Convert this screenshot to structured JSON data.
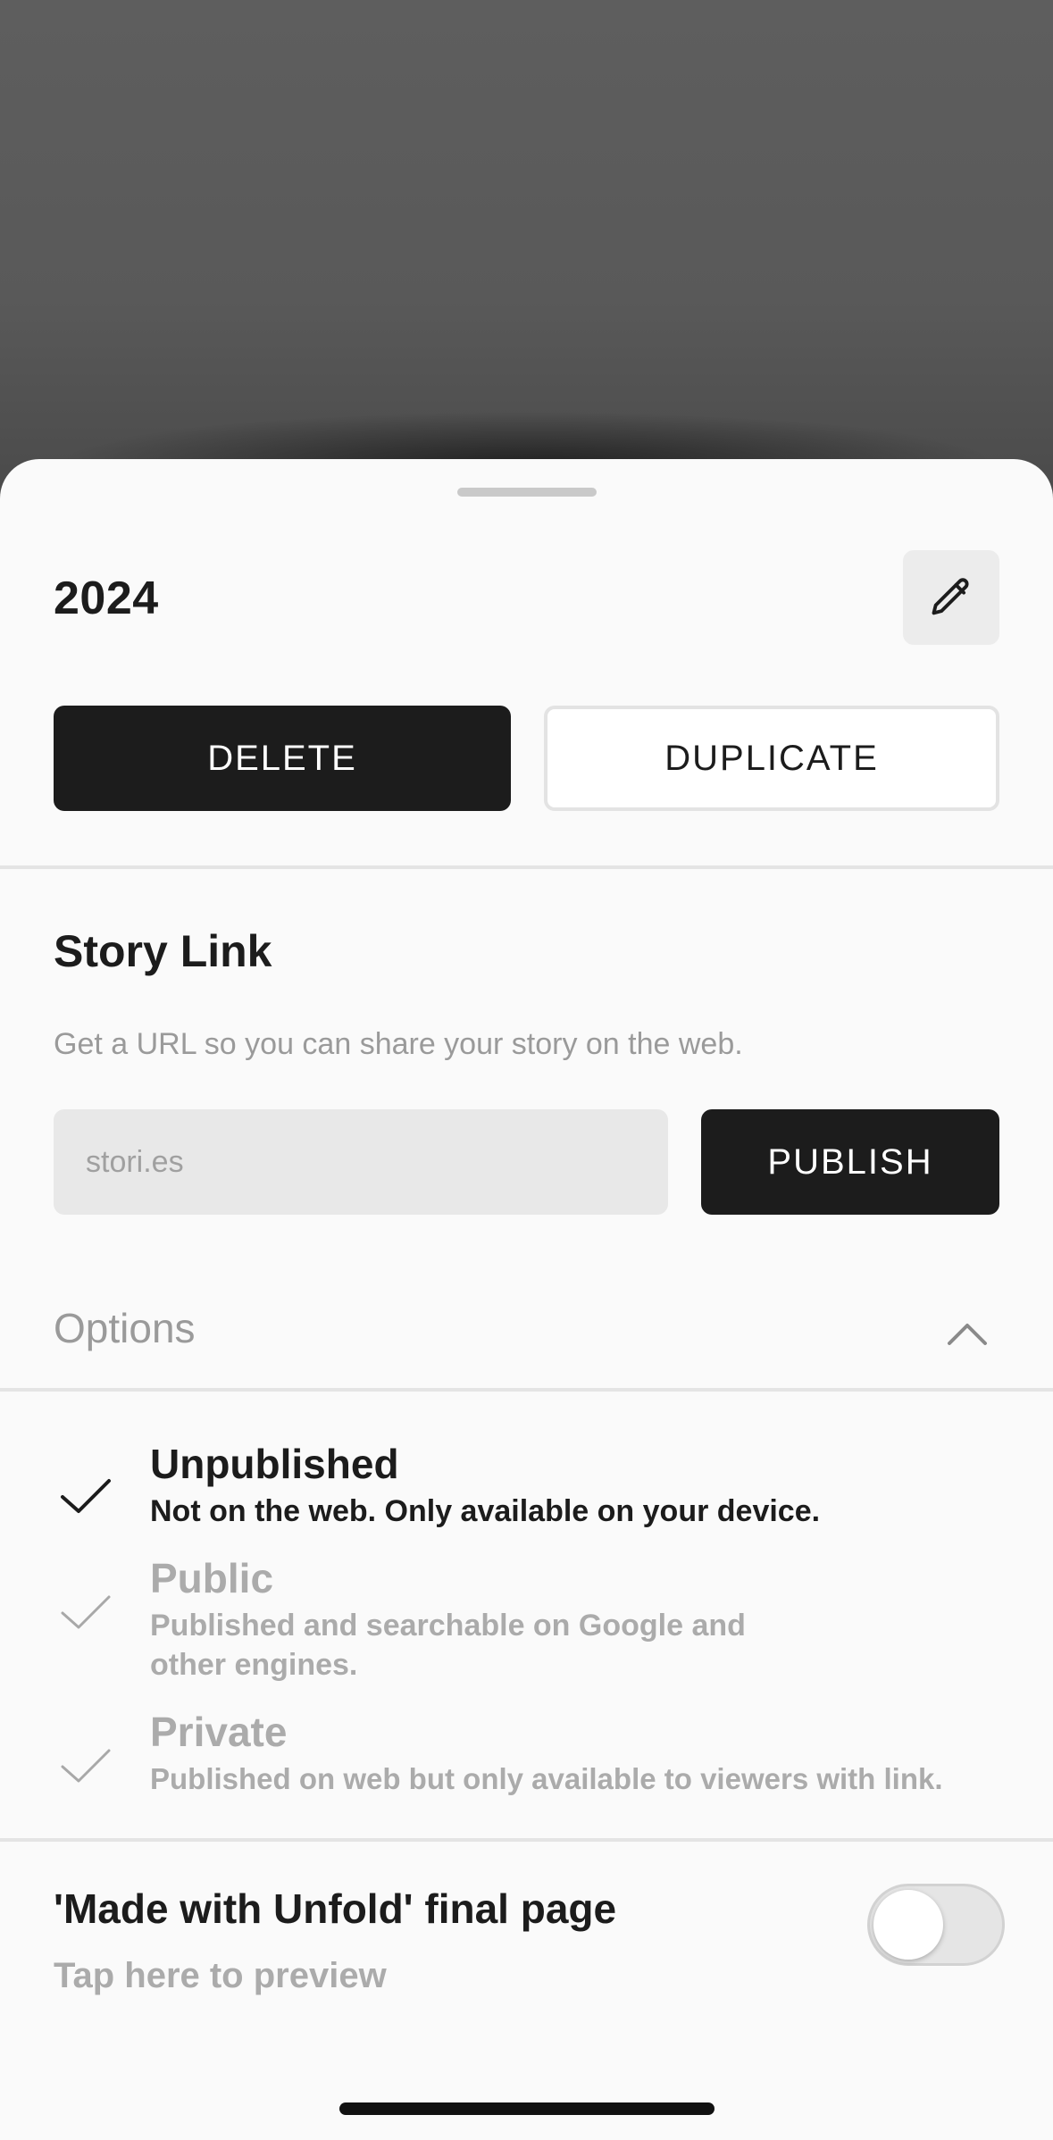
{
  "sheet": {
    "title": "2024"
  },
  "actions": {
    "delete_label": "DELETE",
    "duplicate_label": "DUPLICATE"
  },
  "story_link": {
    "title": "Story Link",
    "description": "Get a URL so you can share your story on the web.",
    "url_placeholder": "stori.es",
    "url_value": "",
    "publish_label": "PUBLISH"
  },
  "options": {
    "label": "Options",
    "expanded": true,
    "items": [
      {
        "title": "Unpublished",
        "description": "Not on the web. Only available on your device.",
        "selected": true
      },
      {
        "title": "Public",
        "description": "Published and searchable on Google and other engines.",
        "selected": false
      },
      {
        "title": "Private",
        "description": "Published on web but only available to viewers with link.",
        "selected": false
      }
    ]
  },
  "final_page": {
    "title": "'Made with Unfold' final page",
    "subtitle": "Tap here to preview",
    "enabled": false
  },
  "colors": {
    "primary": "#1c1c1c",
    "muted_text": "#9a9a9a",
    "sheet_background": "#fafafa",
    "backdrop": "#585858"
  },
  "icons": {
    "edit": "pencil-icon",
    "options_toggle": "chevron-up-icon",
    "option_check": "checkmark-icon"
  }
}
